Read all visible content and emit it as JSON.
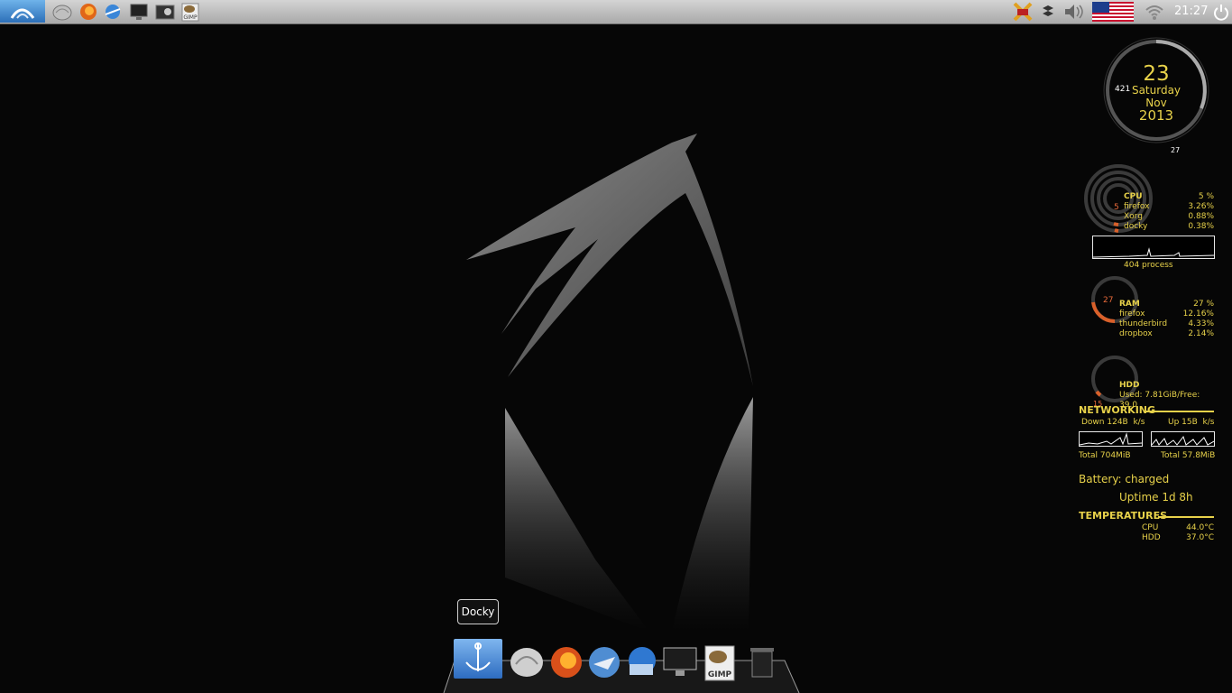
{
  "panel": {
    "menu_icon": "lxle-menu-icon",
    "launchers": [
      "shell-icon",
      "firefox-icon",
      "network-browser-icon",
      "monitor-icon",
      "screenshot-icon",
      "gimp-icon"
    ],
    "tray": {
      "clipit_icon": "clipboard-icon",
      "dropbox_icon": "dropbox-icon",
      "volume_icon": "volume-icon",
      "keyboard_layout_icon": "us-flag-icon",
      "network_icon": "wifi-icon",
      "clock": "21:27",
      "power_icon": "power-icon"
    }
  },
  "conky": {
    "clock": {
      "day": "23",
      "weekday": "Saturday",
      "month": "Nov",
      "year": "2013",
      "small_a": "421",
      "small_b": "27"
    },
    "cpu": {
      "label": "CPU",
      "percent": "5 %",
      "ring_value": "5",
      "procs": [
        {
          "name": "firefox",
          "val": "3.26%"
        },
        {
          "name": "Xorg",
          "val": "0.88%"
        },
        {
          "name": "docky",
          "val": "0.38%"
        }
      ],
      "process_count": "404 process"
    },
    "ram": {
      "label": "RAM",
      "percent": "27 %",
      "ring_value": "27",
      "procs": [
        {
          "name": "firefox",
          "val": "12.16%"
        },
        {
          "name": "thunderbird",
          "val": "4.33%"
        },
        {
          "name": "dropbox",
          "val": "2.14%"
        }
      ]
    },
    "hdd": {
      "label": "HDD",
      "usage": "Used: 7.81GiB/Free: 39.0",
      "ring_value": "15"
    },
    "networking": {
      "title": "NETWORKING",
      "down_label": "Down 124B",
      "up_label": "Up 15B",
      "unit": "k/s",
      "total_down": "Total 704MiB",
      "total_up": "Total 57.8MiB"
    },
    "battery": "Battery: charged",
    "uptime": "Uptime 1d 8h",
    "temperatures": {
      "title": "TEMPERATURES",
      "cpu_label": "CPU",
      "cpu_val": "44.0°C",
      "hdd_label": "HDD",
      "hdd_val": "37.0°C"
    }
  },
  "dock": {
    "tooltip": "Docky",
    "items": [
      "docky-anchor-icon",
      "shell-icon",
      "firefox-icon",
      "thunderbird-icon",
      "network-browser-icon",
      "monitor-icon",
      "gimp-icon",
      "trash-icon"
    ]
  },
  "colors": {
    "conky_text": "#e8d24a",
    "panel_bg": "#bdbdbd",
    "menu_blue": "#2c6fb8",
    "desktop_bg": "#060606"
  }
}
